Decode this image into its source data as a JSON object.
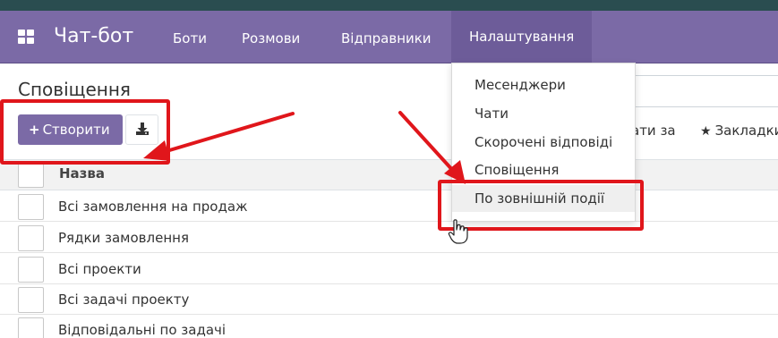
{
  "navbar": {
    "brand": "Чат-бот",
    "menu": [
      "Боти",
      "Розмови",
      "Відправники",
      "Налаштування"
    ],
    "active": "Налаштування"
  },
  "page": {
    "title": "Сповіщення",
    "create_label": "Створити",
    "filters_fragment": "ати за",
    "bookmarks_label": "Закладки"
  },
  "table": {
    "header": "Назва",
    "rows": [
      "Всі замовлення на продаж",
      "Рядки замовлення",
      "Всі проекти",
      "Всі задачі проекту",
      "Відповідальні по задачі"
    ]
  },
  "dropdown": {
    "items": [
      "Месенджери",
      "Чати",
      "Скорочені відповіді",
      "Сповіщення",
      "По зовнішній події"
    ],
    "highlighted": "По зовнішній події"
  },
  "icons": {
    "apps": "grid-icon",
    "download": "download-icon",
    "plus": "plus-icon",
    "star": "star-icon",
    "cursor": "hand-cursor-icon"
  },
  "colors": {
    "navbar": "#7b6aa6",
    "navbar_active": "#6d5c99",
    "primary_button": "#7b6aa6",
    "annotation": "#e0161b"
  }
}
